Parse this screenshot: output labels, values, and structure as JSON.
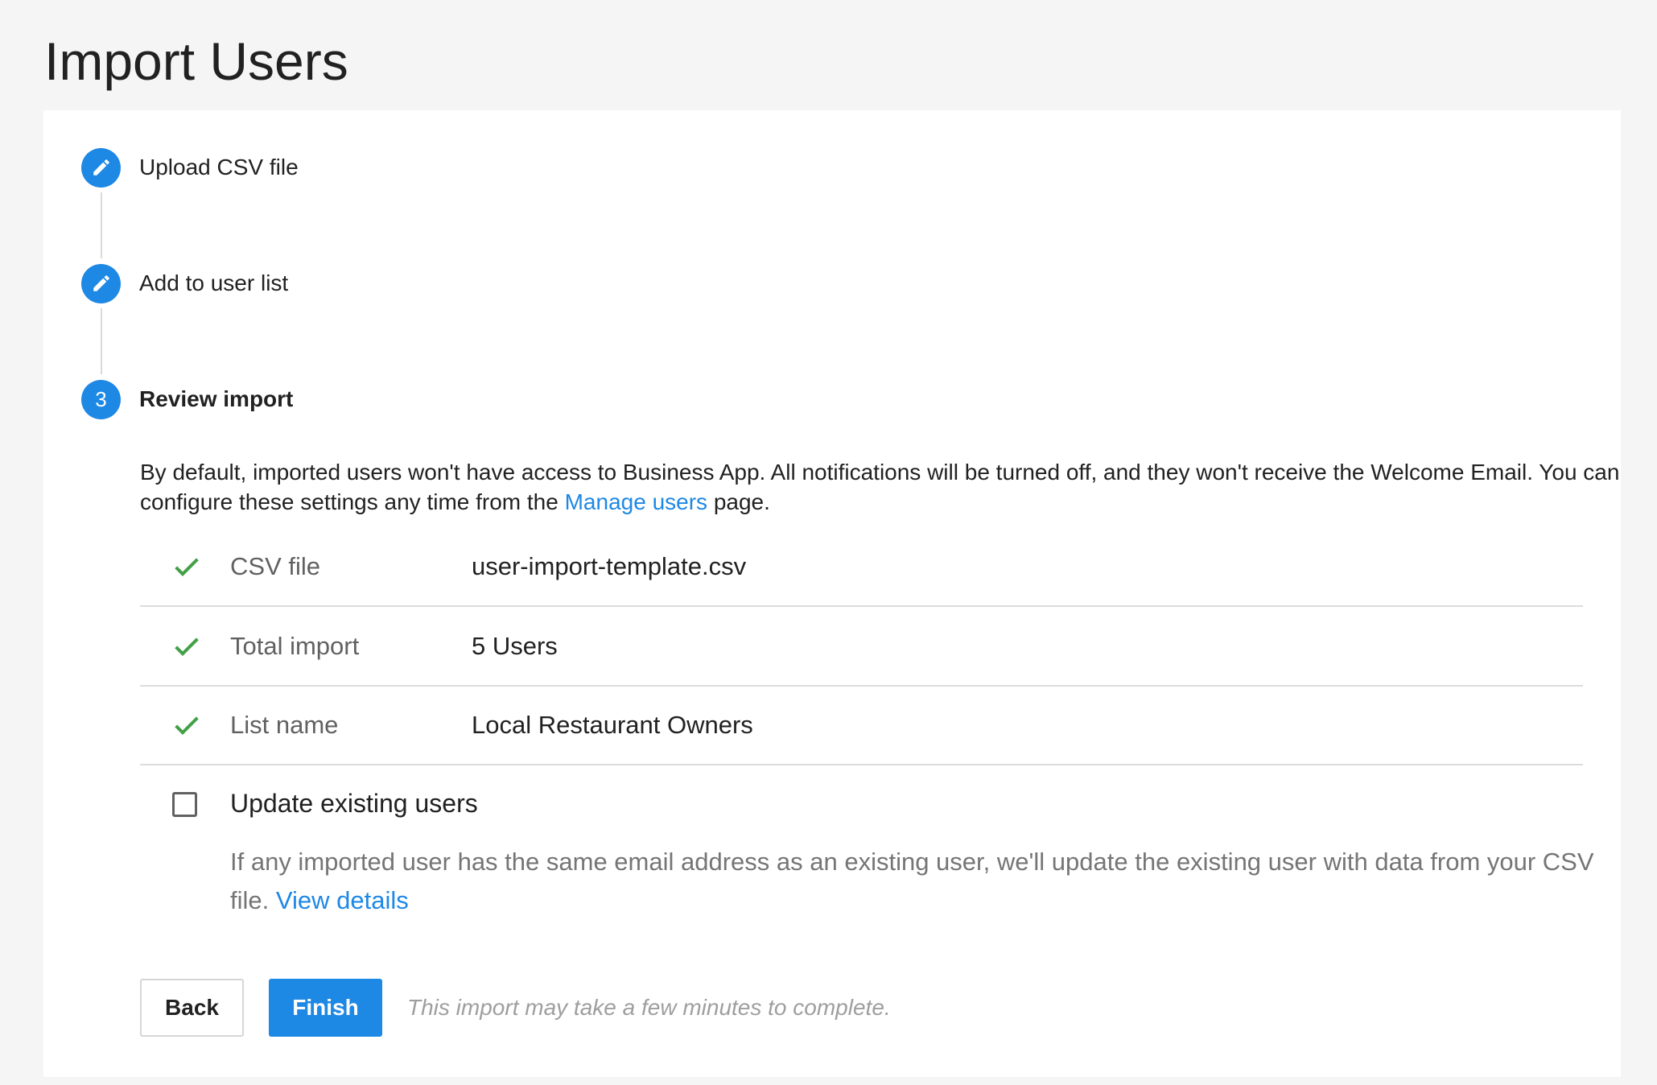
{
  "page": {
    "title": "Import Users"
  },
  "steps": [
    {
      "label": "Upload CSV file",
      "state": "complete",
      "icon": "pencil-icon"
    },
    {
      "label": "Add to user list",
      "state": "complete",
      "icon": "pencil-icon"
    },
    {
      "label": "Review import",
      "state": "active",
      "number": "3"
    }
  ],
  "review": {
    "intro_text": "By default, imported users won't have access to Business App. All notifications will be turned off, and they won't receive the Welcome Email. You can configure these settings any time from the ",
    "intro_link": "Manage users",
    "intro_suffix": " page.",
    "summary": [
      {
        "label": "CSV file",
        "value": "user-import-template.csv",
        "icon": "check-icon"
      },
      {
        "label": "Total import",
        "value": "5 Users",
        "icon": "check-icon"
      },
      {
        "label": "List name",
        "value": "Local Restaurant Owners",
        "icon": "check-icon"
      }
    ],
    "update_existing": {
      "label": "Update existing users",
      "checked": false,
      "hint": "If any imported user has the same email address as an existing user, we'll update the existing user with data from your CSV file. ",
      "hint_link": "View details"
    }
  },
  "actions": {
    "back_label": "Back",
    "finish_label": "Finish",
    "note": "This import may take a few minutes to complete."
  },
  "colors": {
    "accent": "#1e88e5",
    "success": "#43a047",
    "background": "#f5f5f5"
  }
}
